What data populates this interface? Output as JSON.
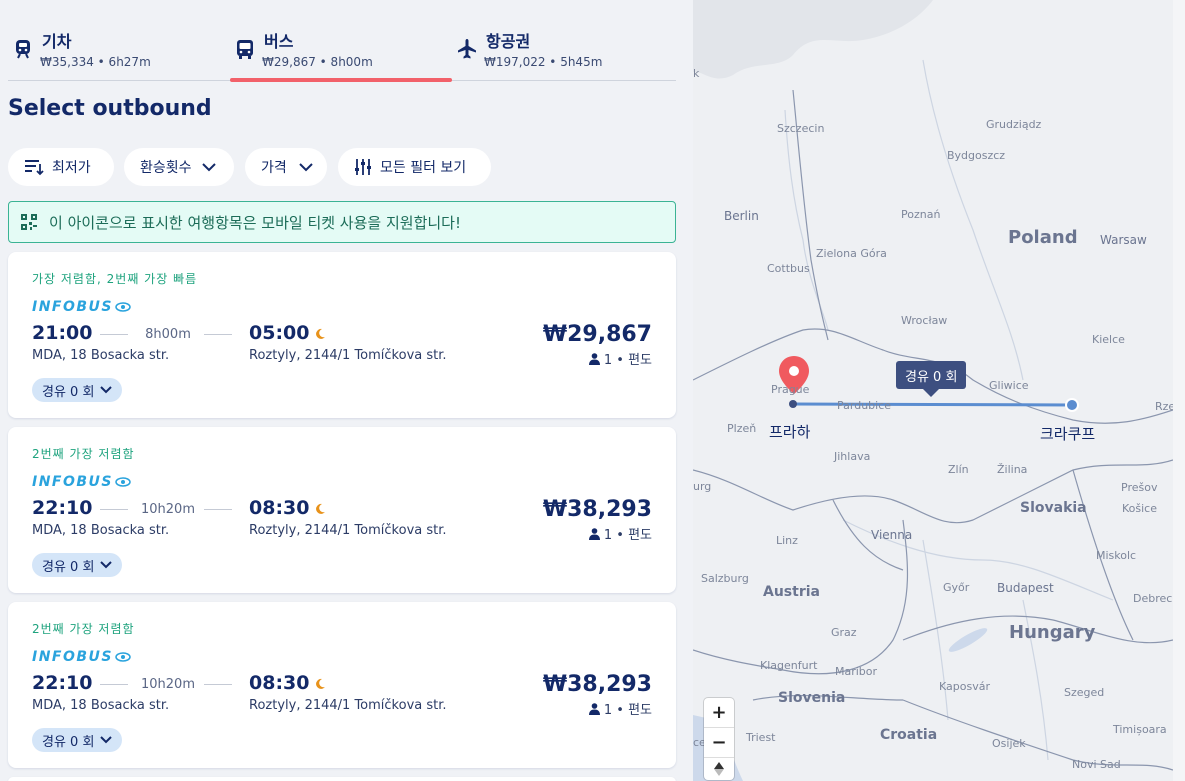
{
  "modes": [
    {
      "title": "기차",
      "sub": "₩35,334 • 6h27m",
      "icon": "train-icon"
    },
    {
      "title": "버스",
      "sub": "₩29,867 • 8h00m",
      "icon": "bus-icon"
    },
    {
      "title": "항공권",
      "sub": "₩197,022 • 5h45m",
      "icon": "plane-icon"
    }
  ],
  "heading": "Select outbound",
  "filters": {
    "sort_label": "최저가",
    "transfers_label": "환승횟수",
    "price_label": "가격",
    "all_filters_label": "모든 필터 보기"
  },
  "notice": "이 아이콘으로 표시한 여행항목은 모바일 티켓 사용을 지원합니다!",
  "results": [
    {
      "tag": "가장 저렴함, 2번째 가장 빠름",
      "carrier": "INFOBUS",
      "dep_time": "21:00",
      "duration": "8h00m",
      "arr_time": "05:00",
      "from": "MDA, 18 Bosacka str.",
      "to": "Roztyly, 2144/1 Tomíčkova str.",
      "price": "₩29,867",
      "pax": "1 • 편도",
      "stops": "경유 0 회"
    },
    {
      "tag": "2번째 가장 저렴함",
      "carrier": "INFOBUS",
      "dep_time": "22:10",
      "duration": "10h20m",
      "arr_time": "08:30",
      "from": "MDA, 18 Bosacka str.",
      "to": "Roztyly, 2144/1 Tomíčkova str.",
      "price": "₩38,293",
      "pax": "1 • 편도",
      "stops": "경유 0 회"
    },
    {
      "tag": "2번째 가장 저렴함",
      "carrier": "INFOBUS",
      "dep_time": "22:10",
      "duration": "10h20m",
      "arr_time": "08:30",
      "from": "MDA, 18 Bosacka str.",
      "to": "Roztyly, 2144/1 Tomíčkova str.",
      "price": "₩38,293",
      "pax": "1 • 편도",
      "stops": "경유 0 회"
    }
  ],
  "map": {
    "route_bubble": "경유 0 회",
    "origin_label": "프라하",
    "destination_label": "크라쿠프",
    "zoom_in": "+",
    "zoom_out": "−",
    "labels": {
      "szczecin": "Szczecin",
      "grudziadz": "Grudziądz",
      "bydgoszcz": "Bydgoszcz",
      "berlin": "Berlin",
      "poznan": "Poznań",
      "poland": "Poland",
      "warsaw": "Warsaw",
      "zielona": "Zielona Góra",
      "cottbus": "Cottbus",
      "wroclaw": "Wrocław",
      "kielce": "Kielce",
      "prague": "Prague",
      "gliwice": "Gliwice",
      "pardubice": "Pardubice",
      "plzen": "Plzeň",
      "rze": "Rze",
      "jihlava": "Jihlava",
      "zlin": "Zlín",
      "zilina": "Žilina",
      "presov": "Prešov",
      "kosice": "Košice",
      "slovakia": "Slovakia",
      "linz": "Linz",
      "vienna": "Vienna",
      "miskolc": "Miskolc",
      "salzburg": "Salzburg",
      "austria": "Austria",
      "gyor": "Győr",
      "budapest": "Budapest",
      "debrec": "Debrec",
      "graz": "Graz",
      "hungary": "Hungary",
      "klagenfurt": "Klagenfurt",
      "maribor": "Maribor",
      "kaposvar": "Kaposvár",
      "szeged": "Szeged",
      "slovenia": "Slovenia",
      "timisoara": "Timișoara",
      "trieste": "Triest",
      "croatia": "Croatia",
      "osijek": "Osijek",
      "novisad": "Novi Sad",
      "k": "k",
      "urg": "urg",
      "ce": "ce"
    }
  }
}
